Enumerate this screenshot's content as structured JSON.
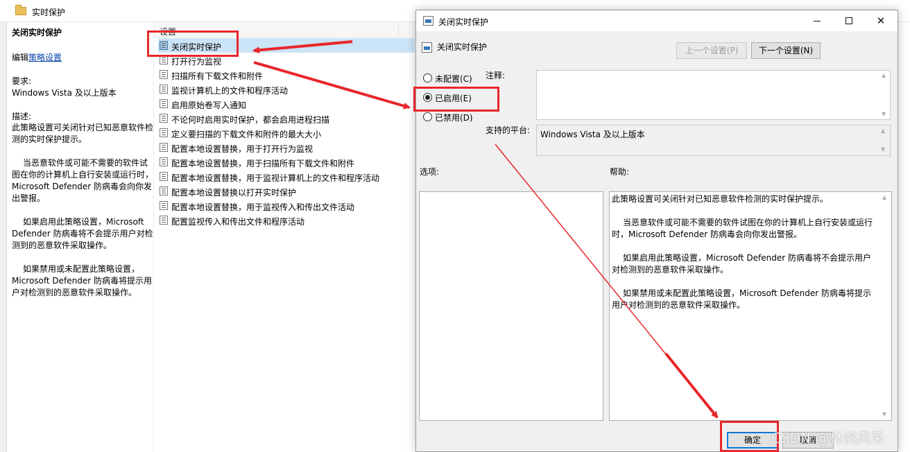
{
  "background_window": {
    "title": "实时保护"
  },
  "description_pane": {
    "title": "关闭实时保护",
    "edit_prefix": "编辑",
    "edit_link": "策略设置",
    "requirements_label": "要求:",
    "requirements_value": "Windows Vista 及以上版本",
    "description_label": "描述:",
    "paragraphs": [
      "此策略设置可关闭针对已知恶意软件检测的实时保护提示。",
      "当恶意软件或可能不需要的软件试图在你的计算机上自行安装或运行时，Microsoft Defender 防病毒会向你发出警报。",
      "如果启用此策略设置，Microsoft Defender 防病毒将不会提示用户对检测到的恶意软件采取操作。",
      "如果禁用或未配置此策略设置，Microsoft Defender 防病毒将提示用户对检测到的恶意软件采取操作。"
    ]
  },
  "settings_list": {
    "header": "设置",
    "items": [
      "关闭实时保护",
      "打开行为监视",
      "扫描所有下载文件和附件",
      "监视计算机上的文件和程序活动",
      "启用原始卷写入通知",
      "不论何时启用实时保护，都会启用进程扫描",
      "定义要扫描的下载文件和附件的最大大小",
      "配置本地设置替换，用于打开行为监视",
      "配置本地设置替换，用于扫描所有下载文件和附件",
      "配置本地设置替换，用于监视计算机上的文件和程序活动",
      "配置本地设置替换以打开实时保护",
      "配置本地设置替换，用于监视传入和传出文件活动",
      "配置监视传入和传出文件和程序活动"
    ]
  },
  "dialog": {
    "title": "关闭实时保护",
    "window_buttons": {
      "minimize": "",
      "maximize": "",
      "close": "✕"
    },
    "policy_name": "关闭实时保护",
    "prev_button": "上一个设置(P)",
    "next_button": "下一个设置(N)",
    "radios": [
      {
        "label": "未配置(C)",
        "checked": false
      },
      {
        "label": "已启用(E)",
        "checked": true
      },
      {
        "label": "已禁用(D)",
        "checked": false
      }
    ],
    "comment_label": "注释:",
    "comment_value": "",
    "platform_label": "支持的平台:",
    "platform_value": "Windows Vista 及以上版本",
    "options_label": "选项:",
    "help_label": "帮助:",
    "help_paragraphs": [
      "此策略设置可关闭针对已知恶意软件检测的实时保护提示。",
      "当恶意软件或可能不需要的软件试图在你的计算机上自行安装或运行时，Microsoft Defender 防病毒会向你发出警报。",
      "如果启用此策略设置，Microsoft Defender 防病毒将不会提示用户对检测到的恶意软件采取操作。",
      "如果禁用或未配置此策略设置，Microsoft Defender 防病毒将提示用户对检测到的恶意软件采取操作。"
    ],
    "ok_button": "确定",
    "cancel_button": "取消"
  },
  "watermark": "CSDN @林鸽风采",
  "colors": {
    "annotation_red": "#e8262b",
    "selection_blue": "#cce4f7",
    "link_blue": "#0645ad",
    "focus_blue": "#0078d7"
  }
}
